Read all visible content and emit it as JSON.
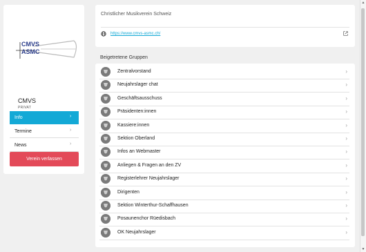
{
  "club": {
    "name": "CMVS",
    "type": "PRIVAT",
    "logo_text_line1": "CMVS",
    "logo_text_line2": "ASMC"
  },
  "nav": {
    "items": [
      {
        "label": "Info",
        "active": true
      },
      {
        "label": "Termine",
        "active": false
      },
      {
        "label": "News",
        "active": false
      }
    ],
    "leave_label": "Verein verlassen"
  },
  "info": {
    "full_name": "Christlicher Musikverein Schweiz",
    "website": "https://www.cmvs-asmc.ch/"
  },
  "groups": {
    "title": "Beigetretene Gruppen",
    "items": [
      "Zentralvorstand",
      "Neujahrslager chat",
      "Geschäftsausschuss",
      "Präsidenten:innen",
      "Kassiere:innen",
      "Sektion Oberland",
      "Infos an Webmaster",
      "Anliegen & Fragen an den ZV",
      "Registerlehrer Neujahrslager",
      "Dirigenten",
      "Sektion Winterthur-Schaffhausen",
      "Posaunenchor Rüedisbach",
      "OK Neujahrslager"
    ]
  },
  "colors": {
    "accent": "#13a9d6",
    "danger": "#e34a59",
    "background": "#f0f0f0"
  }
}
